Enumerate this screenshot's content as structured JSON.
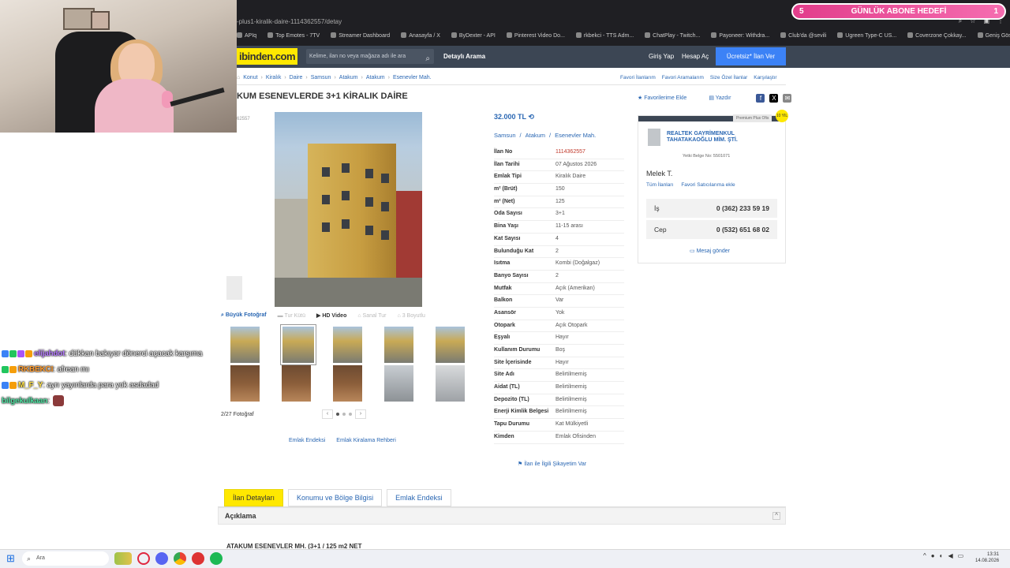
{
  "stream": {
    "sub_goal": {
      "left": "5",
      "label": "GÜNLÜK ABONE HEDEFİ",
      "right": "1"
    },
    "chat": [
      {
        "user": "elijahdot",
        "message": ": dükkan bakıyor dönerci açacak karşıma",
        "user_color": "#b77cff"
      },
      {
        "user": "RKBEKCI",
        "message": ": afrean mı",
        "user_color": "#ff9b2e"
      },
      {
        "user": "M_F_Y",
        "message": ": ayrı yayınlarda para yok asdadad",
        "user_color": "#ffe14a"
      },
      {
        "user": "bilgekulkaan",
        "message": ":",
        "user_color": "#4ee0a0"
      }
    ]
  },
  "browser": {
    "url": "-plus1-kiralik-daire-1114362557/detay",
    "bookmarks": [
      "APIq",
      "Top Emotes - 7TV",
      "Streamer Dashboard",
      "Anasayfa / X",
      "ByDexter - API",
      "Pinterest Video Do...",
      "rkbekci - TTS Adm...",
      "ChatPlay - Twitch...",
      "Payoneer: Withdra...",
      "Club'da @sevili",
      "Ugreen Type-C US...",
      "Coverzone Çokkay...",
      "Geniş Gösterekler..."
    ]
  },
  "site": {
    "logo": "ibinden.com",
    "search_placeholder": "Kelime, ilan no veya mağaza adı ile ara",
    "advanced_search": "Detaylı Arama",
    "login": "Giriş Yap",
    "signup": "Hesap Aç",
    "post_ad": "Ücretsiz* İlan Ver",
    "breadcrumb": [
      "Konut",
      "Kiralık",
      "Daire",
      "Samsun",
      "Atakum",
      "Atakum",
      "Esenevler Mah."
    ],
    "fav_links": [
      "Favori İlanlarım",
      "Favori Aramalarım",
      "Size Özel İlanlar",
      "Karşılaştır"
    ]
  },
  "listing": {
    "title": "KUM ESENEVLERDE 3+1 KİRALIK DAİRE",
    "id_small": "62557",
    "add_fav": "Favorilerime Ekle",
    "print": "Yazdır",
    "price": "32.000 TL",
    "location": [
      "Samsun",
      "/",
      "Atakum",
      "/",
      "Esenevler Mah."
    ],
    "media": {
      "large_photo": "Büyük Fotoğraf",
      "video_tour": "Tur Kütü",
      "hd_video": "HD Video",
      "virtual_tour": "Sanal Tur",
      "three_d": "3 Boyutlu"
    },
    "photo_count": "2/27 Fotoğraf",
    "links_below": [
      "Emlak Endeksi",
      "Emlak Kiralama Rehberi"
    ],
    "info": [
      {
        "k": "İlan No",
        "v": "1114362557",
        "red": true
      },
      {
        "k": "İlan Tarihi",
        "v": "07 Ağustos 2026"
      },
      {
        "k": "Emlak Tipi",
        "v": "Kiralık Daire"
      },
      {
        "k": "m² (Brüt)",
        "v": "150"
      },
      {
        "k": "m² (Net)",
        "v": "125"
      },
      {
        "k": "Oda Sayısı",
        "v": "3+1"
      },
      {
        "k": "Bina Yaşı",
        "v": "11-15 arası"
      },
      {
        "k": "Kat Sayısı",
        "v": "4"
      },
      {
        "k": "Bulunduğu Kat",
        "v": "2"
      },
      {
        "k": "Isıtma",
        "v": "Kombi (Doğalgaz)"
      },
      {
        "k": "Banyo Sayısı",
        "v": "2"
      },
      {
        "k": "Mutfak",
        "v": "Açık (Amerikan)"
      },
      {
        "k": "Balkon",
        "v": "Var"
      },
      {
        "k": "Asansör",
        "v": "Yok"
      },
      {
        "k": "Otopark",
        "v": "Açık Otopark"
      },
      {
        "k": "Eşyalı",
        "v": "Hayır"
      },
      {
        "k": "Kullanım Durumu",
        "v": "Boş"
      },
      {
        "k": "Site İçerisinde",
        "v": "Hayır"
      },
      {
        "k": "Site Adı",
        "v": "Belirtilmemiş"
      },
      {
        "k": "Aidat (TL)",
        "v": "Belirtilmemiş"
      },
      {
        "k": "Depozito (TL)",
        "v": "Belirtilmemiş"
      },
      {
        "k": "Enerji Kimlik Belgesi",
        "v": "Belirtilmemiş"
      },
      {
        "k": "Tapu Durumu",
        "v": "Kat Mülkiyetli"
      },
      {
        "k": "Kimden",
        "v": "Emlak Ofisinden"
      }
    ],
    "complain": "İlan ile İlgili Şikayetim Var"
  },
  "seller": {
    "premium": "Premium Plus Ofis",
    "star": "10 YIL",
    "office_name": "REALTEK GAYRİMENKUL TAHATAKAOĞLU MİM. ŞTİ.",
    "cert": "Yetki Belge No:  5501071",
    "agent": "Melek T.",
    "all_ads": "Tüm İlanları",
    "fav_seller": "Favori Satıcılarıma ekle",
    "phones": [
      {
        "label": "İş",
        "number": "0 (362) 233 59 19"
      },
      {
        "label": "Cep",
        "number": "0 (532) 651 68 02"
      }
    ],
    "message": "Mesaj gönder"
  },
  "tabs": [
    "İlan Detayları",
    "Konumu ve Bölge Bilgisi",
    "Emlak Endeksi"
  ],
  "description": {
    "header": "Açıklama",
    "first_line": "ATAKUM ESENEVLER MH. (3+1 / 125 m2 NET"
  },
  "taskbar": {
    "search": "Ara",
    "time": "13:31",
    "date": "14.08.2026"
  }
}
